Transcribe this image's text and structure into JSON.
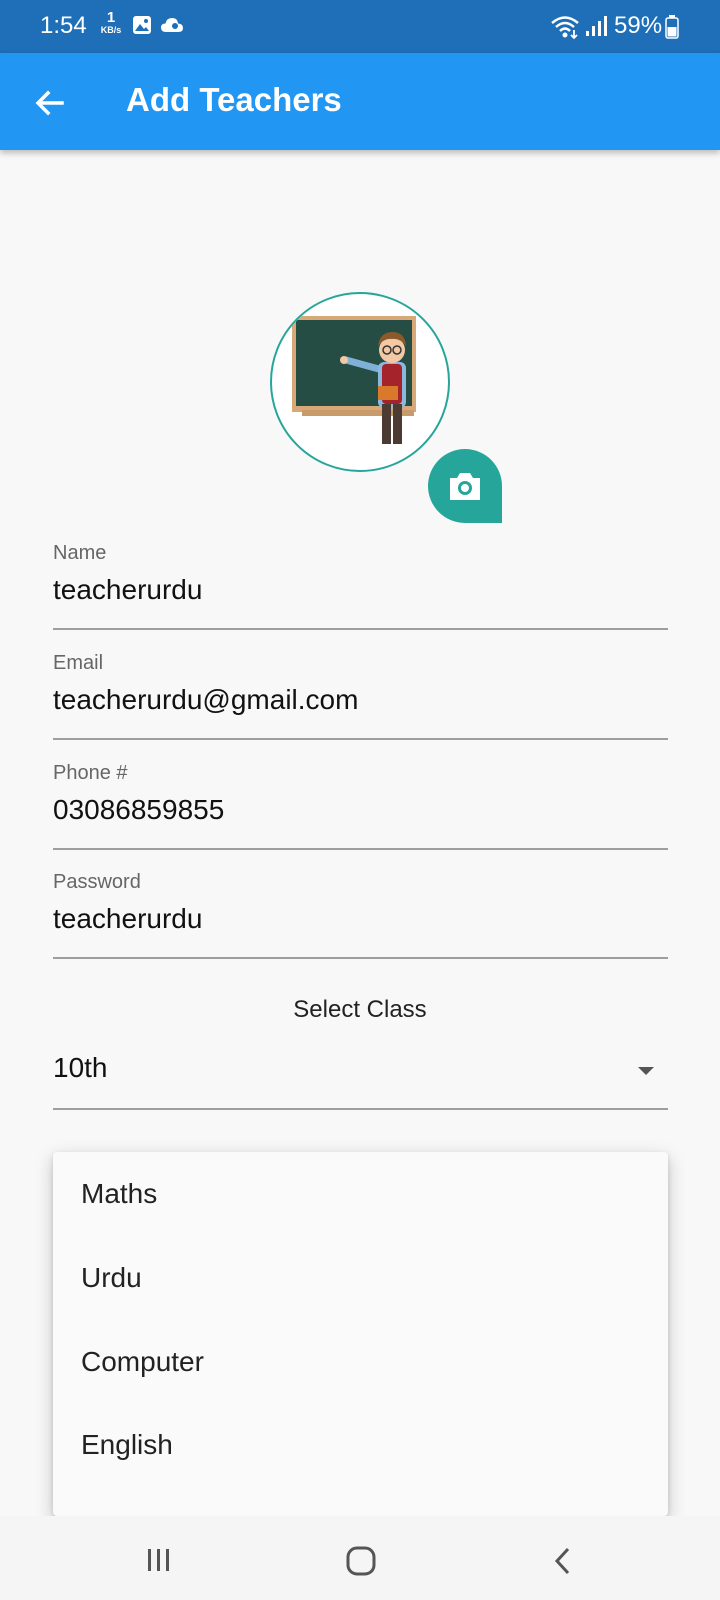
{
  "status_bar": {
    "time": "1:54",
    "speed_value": "1",
    "speed_unit": "KB/s",
    "battery": "59%",
    "icons": [
      "gallery-icon",
      "cloud-icon",
      "wifi-icon",
      "signal-icon",
      "battery-icon"
    ]
  },
  "app_bar": {
    "title": "Add Teachers",
    "back_icon": "arrow-left-icon",
    "color": "#2196f3"
  },
  "profile": {
    "avatar": "teacher-illustration",
    "camera_icon": "camera-icon",
    "accent": "#26a69a"
  },
  "form": {
    "name": {
      "label": "Name",
      "value": "teacherurdu"
    },
    "email": {
      "label": "Email",
      "value": "teacherurdu@gmail.com"
    },
    "phone": {
      "label": "Phone #",
      "value": "03086859855"
    },
    "password": {
      "label": "Password",
      "value": "teacherurdu"
    },
    "select_class_label": "Select Class",
    "class_value": "10th"
  },
  "subject_menu": {
    "items": [
      "Maths",
      "Urdu",
      "Computer",
      "English"
    ]
  },
  "nav_bar": {
    "icons": [
      "recent-apps-icon",
      "home-icon",
      "back-icon"
    ]
  }
}
